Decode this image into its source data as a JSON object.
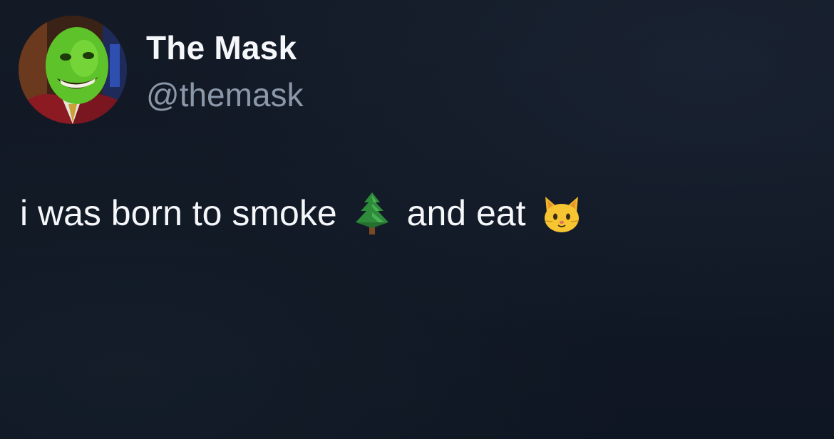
{
  "profile": {
    "display_name": "The Mask",
    "handle": "@themask",
    "avatar_icon": "green-mask-face-avatar"
  },
  "tweet": {
    "text_part_1": "i was born to smoke",
    "emoji_1": "evergreen-tree-emoji",
    "text_part_2": "and eat",
    "emoji_2": "cat-face-emoji"
  },
  "colors": {
    "background": "#111827",
    "name": "#f5f7fa",
    "handle": "#8b98a9",
    "text": "#f5f7fa"
  }
}
